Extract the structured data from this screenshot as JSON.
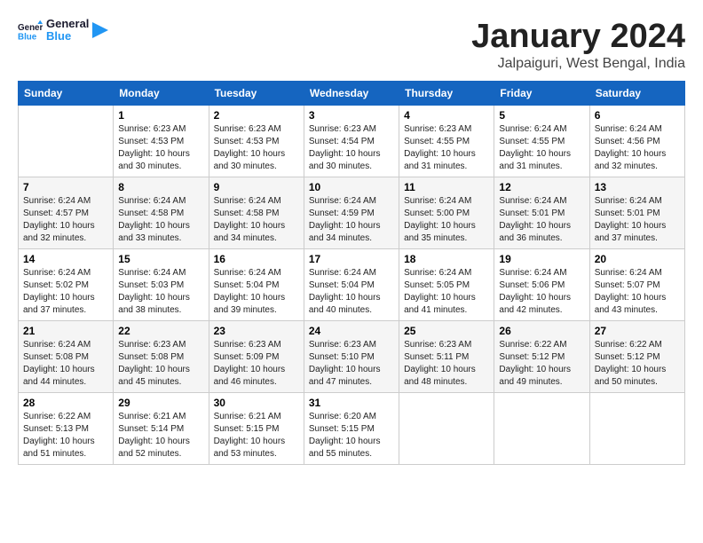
{
  "logo": {
    "text_general": "General",
    "text_blue": "Blue"
  },
  "header": {
    "month": "January 2024",
    "location": "Jalpaiguri, West Bengal, India"
  },
  "weekdays": [
    "Sunday",
    "Monday",
    "Tuesday",
    "Wednesday",
    "Thursday",
    "Friday",
    "Saturday"
  ],
  "weeks": [
    [
      {
        "day": "",
        "sunrise": "",
        "sunset": "",
        "daylight": ""
      },
      {
        "day": "1",
        "sunrise": "Sunrise: 6:23 AM",
        "sunset": "Sunset: 4:53 PM",
        "daylight": "Daylight: 10 hours and 30 minutes."
      },
      {
        "day": "2",
        "sunrise": "Sunrise: 6:23 AM",
        "sunset": "Sunset: 4:53 PM",
        "daylight": "Daylight: 10 hours and 30 minutes."
      },
      {
        "day": "3",
        "sunrise": "Sunrise: 6:23 AM",
        "sunset": "Sunset: 4:54 PM",
        "daylight": "Daylight: 10 hours and 30 minutes."
      },
      {
        "day": "4",
        "sunrise": "Sunrise: 6:23 AM",
        "sunset": "Sunset: 4:55 PM",
        "daylight": "Daylight: 10 hours and 31 minutes."
      },
      {
        "day": "5",
        "sunrise": "Sunrise: 6:24 AM",
        "sunset": "Sunset: 4:55 PM",
        "daylight": "Daylight: 10 hours and 31 minutes."
      },
      {
        "day": "6",
        "sunrise": "Sunrise: 6:24 AM",
        "sunset": "Sunset: 4:56 PM",
        "daylight": "Daylight: 10 hours and 32 minutes."
      }
    ],
    [
      {
        "day": "7",
        "sunrise": "Sunrise: 6:24 AM",
        "sunset": "Sunset: 4:57 PM",
        "daylight": "Daylight: 10 hours and 32 minutes."
      },
      {
        "day": "8",
        "sunrise": "Sunrise: 6:24 AM",
        "sunset": "Sunset: 4:58 PM",
        "daylight": "Daylight: 10 hours and 33 minutes."
      },
      {
        "day": "9",
        "sunrise": "Sunrise: 6:24 AM",
        "sunset": "Sunset: 4:58 PM",
        "daylight": "Daylight: 10 hours and 34 minutes."
      },
      {
        "day": "10",
        "sunrise": "Sunrise: 6:24 AM",
        "sunset": "Sunset: 4:59 PM",
        "daylight": "Daylight: 10 hours and 34 minutes."
      },
      {
        "day": "11",
        "sunrise": "Sunrise: 6:24 AM",
        "sunset": "Sunset: 5:00 PM",
        "daylight": "Daylight: 10 hours and 35 minutes."
      },
      {
        "day": "12",
        "sunrise": "Sunrise: 6:24 AM",
        "sunset": "Sunset: 5:01 PM",
        "daylight": "Daylight: 10 hours and 36 minutes."
      },
      {
        "day": "13",
        "sunrise": "Sunrise: 6:24 AM",
        "sunset": "Sunset: 5:01 PM",
        "daylight": "Daylight: 10 hours and 37 minutes."
      }
    ],
    [
      {
        "day": "14",
        "sunrise": "Sunrise: 6:24 AM",
        "sunset": "Sunset: 5:02 PM",
        "daylight": "Daylight: 10 hours and 37 minutes."
      },
      {
        "day": "15",
        "sunrise": "Sunrise: 6:24 AM",
        "sunset": "Sunset: 5:03 PM",
        "daylight": "Daylight: 10 hours and 38 minutes."
      },
      {
        "day": "16",
        "sunrise": "Sunrise: 6:24 AM",
        "sunset": "Sunset: 5:04 PM",
        "daylight": "Daylight: 10 hours and 39 minutes."
      },
      {
        "day": "17",
        "sunrise": "Sunrise: 6:24 AM",
        "sunset": "Sunset: 5:04 PM",
        "daylight": "Daylight: 10 hours and 40 minutes."
      },
      {
        "day": "18",
        "sunrise": "Sunrise: 6:24 AM",
        "sunset": "Sunset: 5:05 PM",
        "daylight": "Daylight: 10 hours and 41 minutes."
      },
      {
        "day": "19",
        "sunrise": "Sunrise: 6:24 AM",
        "sunset": "Sunset: 5:06 PM",
        "daylight": "Daylight: 10 hours and 42 minutes."
      },
      {
        "day": "20",
        "sunrise": "Sunrise: 6:24 AM",
        "sunset": "Sunset: 5:07 PM",
        "daylight": "Daylight: 10 hours and 43 minutes."
      }
    ],
    [
      {
        "day": "21",
        "sunrise": "Sunrise: 6:24 AM",
        "sunset": "Sunset: 5:08 PM",
        "daylight": "Daylight: 10 hours and 44 minutes."
      },
      {
        "day": "22",
        "sunrise": "Sunrise: 6:23 AM",
        "sunset": "Sunset: 5:08 PM",
        "daylight": "Daylight: 10 hours and 45 minutes."
      },
      {
        "day": "23",
        "sunrise": "Sunrise: 6:23 AM",
        "sunset": "Sunset: 5:09 PM",
        "daylight": "Daylight: 10 hours and 46 minutes."
      },
      {
        "day": "24",
        "sunrise": "Sunrise: 6:23 AM",
        "sunset": "Sunset: 5:10 PM",
        "daylight": "Daylight: 10 hours and 47 minutes."
      },
      {
        "day": "25",
        "sunrise": "Sunrise: 6:23 AM",
        "sunset": "Sunset: 5:11 PM",
        "daylight": "Daylight: 10 hours and 48 minutes."
      },
      {
        "day": "26",
        "sunrise": "Sunrise: 6:22 AM",
        "sunset": "Sunset: 5:12 PM",
        "daylight": "Daylight: 10 hours and 49 minutes."
      },
      {
        "day": "27",
        "sunrise": "Sunrise: 6:22 AM",
        "sunset": "Sunset: 5:12 PM",
        "daylight": "Daylight: 10 hours and 50 minutes."
      }
    ],
    [
      {
        "day": "28",
        "sunrise": "Sunrise: 6:22 AM",
        "sunset": "Sunset: 5:13 PM",
        "daylight": "Daylight: 10 hours and 51 minutes."
      },
      {
        "day": "29",
        "sunrise": "Sunrise: 6:21 AM",
        "sunset": "Sunset: 5:14 PM",
        "daylight": "Daylight: 10 hours and 52 minutes."
      },
      {
        "day": "30",
        "sunrise": "Sunrise: 6:21 AM",
        "sunset": "Sunset: 5:15 PM",
        "daylight": "Daylight: 10 hours and 53 minutes."
      },
      {
        "day": "31",
        "sunrise": "Sunrise: 6:20 AM",
        "sunset": "Sunset: 5:15 PM",
        "daylight": "Daylight: 10 hours and 55 minutes."
      },
      {
        "day": "",
        "sunrise": "",
        "sunset": "",
        "daylight": ""
      },
      {
        "day": "",
        "sunrise": "",
        "sunset": "",
        "daylight": ""
      },
      {
        "day": "",
        "sunrise": "",
        "sunset": "",
        "daylight": ""
      }
    ]
  ]
}
